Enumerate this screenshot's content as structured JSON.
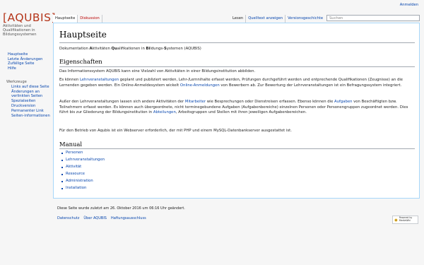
{
  "personal": {
    "login": "Anmelden"
  },
  "logo": {
    "name": "[AQUBIS]",
    "tagline": "Aktivitäten und Qualifikationen in Bildungssystemen"
  },
  "navigation": {
    "items": [
      "Hauptseite",
      "Letzte Änderungen",
      "Zufällige Seite",
      "Hilfe"
    ]
  },
  "toolbox": {
    "heading": "Werkzeuge",
    "items": [
      "Links auf diese Seite",
      "Änderungen an verlinkten Seiten",
      "Spezialseiten",
      "Druckversion",
      "Permanenter Link",
      "Seiten-informationen"
    ]
  },
  "tabs": {
    "left": [
      "Hauptseite",
      "Diskussion"
    ],
    "right": [
      "Lesen",
      "Quelltext anzeigen",
      "Versionsgeschichte"
    ]
  },
  "search": {
    "placeholder": "Suchen"
  },
  "article": {
    "title": "Hauptseite",
    "intro": {
      "p1": "Dokumentation ",
      "A": "A",
      "p2": "ktivitäten ",
      "Qu": "Qu",
      "p3": "alifikationen in ",
      "Bi": "Bi",
      "p4": "ldungs-",
      "S": "S",
      "p5": "ystemen (AQUBIS)"
    },
    "eigenschaften_heading": "Eigenschaften",
    "para1": "Das Informationssystem AQUBIS kann eine Vielzahl von Aktivitäten in einer Bildungsinstitution abbilden.",
    "para2": {
      "a": "Es können ",
      "link1": "Lehrveranstaltungen",
      "b": " geplant und publiziert werden, Lehr-/Lernnihalte erfasst werden, Prüfungen durchgeführt werden und entprechende Qualifikationen (Zeugnisse) an die Lernenden gegeben werden. Ein Online-Anmeldesystem wickelt ",
      "link2": "Online-Anmeldungen",
      "c": " von Bewerbern ab. Zur Bewertung der Lehrveranstaltungen ist ein Befragungssystem integriert."
    },
    "para3": {
      "a": "Außer den Lehrveranstaltungen lassen sich andere Aktivitäten der ",
      "link1": "Mitarbeiter",
      "b": " wie Besprechungen oder Dienstreisen erfassen. Ebenso können die ",
      "link2": "Aufgaben",
      "c": " von Beschäftigten bzw. Teilnehmern erfasst werden. Es können auch übergeordnete, nicht terminegebundene Aufgaben (Aufgabenbereiche) einzelnen Personen oder Personengruppen zugeordnet werden. Dies führt bis zur Gliederung der Bildungsinstitution in ",
      "link3": "Abteilungen",
      "d": ", Arbeitsgruppen und Stellen mit ihren jeweiligen Aufgabenbereichen."
    },
    "para4": "Für den Betrieb von Aqubis ist ein Webserver erforderlich, der mit PHP und einem MySQL-Datenbankserver ausgestattet ist.",
    "manual_heading": "Manual",
    "manual_items": [
      "Personen",
      "Lehrveranstaltungen",
      "Aktivität",
      "Ressource",
      "Administration",
      "Installation"
    ]
  },
  "footer": {
    "info": "Diese Seite wurde zuletzt am 26. Oktober 2016 um 06:16 Uhr geändert.",
    "places": [
      "Datenschutz",
      "Über AQUBIS",
      "Haftungsausschluss"
    ],
    "poweredby": "Powered by MediaWiki"
  }
}
